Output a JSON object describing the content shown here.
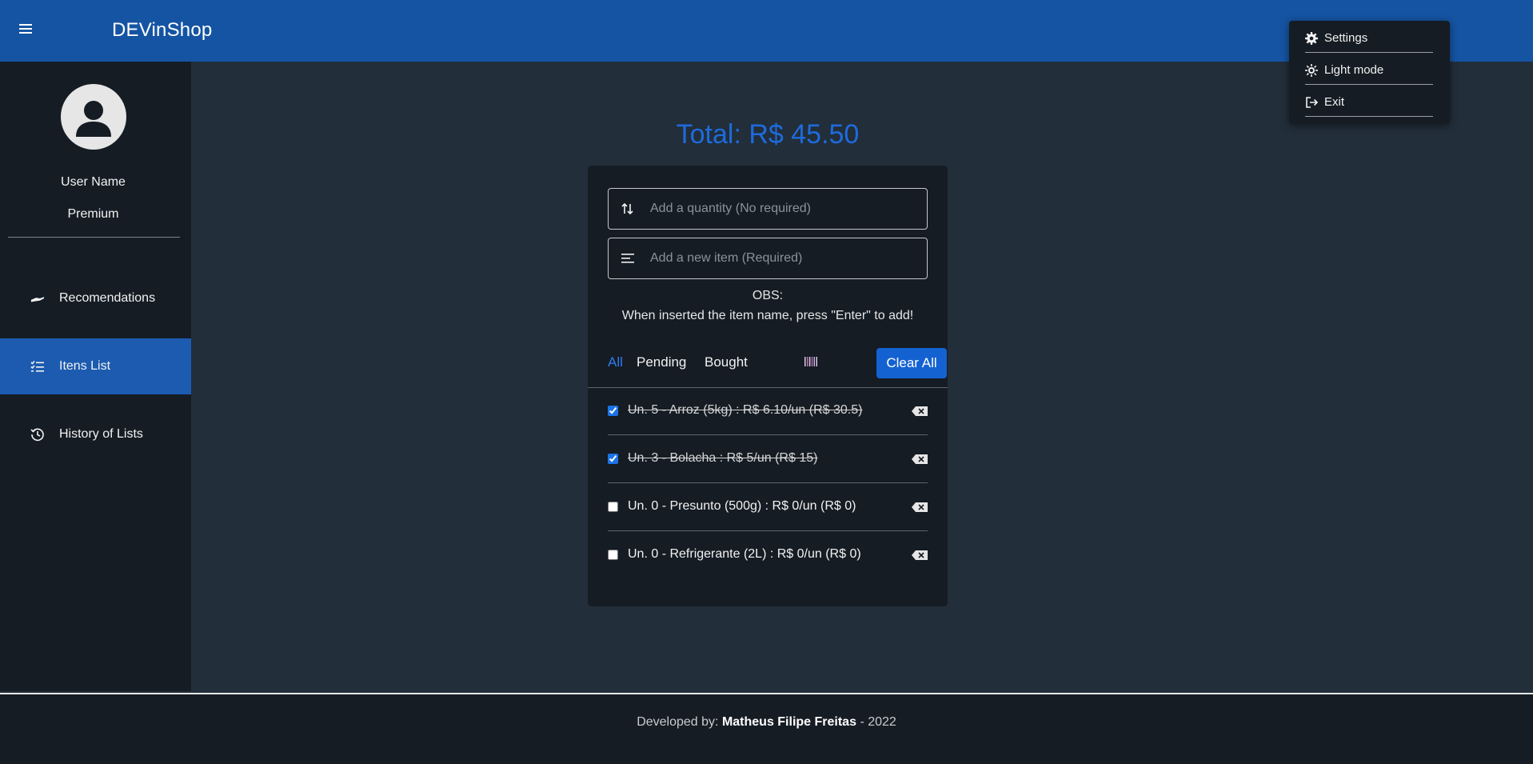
{
  "header": {
    "title": "DEVinShop"
  },
  "sidebar": {
    "user_name": "User Name",
    "user_plan": "Premium",
    "items": [
      {
        "label": "Recomendations",
        "icon": "hand-icon",
        "active": false
      },
      {
        "label": "Itens List",
        "icon": "checklist-icon",
        "active": true
      },
      {
        "label": "History of Lists",
        "icon": "history-icon",
        "active": false
      }
    ]
  },
  "main": {
    "total": "Total: R$ 45.50",
    "quantity_placeholder": "Add a quantity (No required)",
    "item_placeholder": "Add a new item (Required)",
    "obs_title": "OBS:",
    "obs_text": "When inserted the item name, press \"Enter\" to add!",
    "tabs": [
      {
        "label": "All",
        "active": true
      },
      {
        "label": "Pending",
        "active": false
      },
      {
        "label": "Bought",
        "active": false
      }
    ],
    "clear_all_label": "Clear All",
    "items": [
      {
        "text": "Un. 5 - Arroz (5kg) : R$ 6.10/un (R$ 30.5)",
        "checked": true
      },
      {
        "text": "Un. 3 - Bolacha : R$ 5/un (R$ 15)",
        "checked": true
      },
      {
        "text": "Un. 0 - Presunto (500g) : R$ 0/un (R$ 0)",
        "checked": false
      },
      {
        "text": "Un. 0 - Refrigerante (2L) : R$ 0/un (R$ 0)",
        "checked": false
      }
    ]
  },
  "dropdown": {
    "items": [
      {
        "label": "Settings",
        "icon": "gear-icon"
      },
      {
        "label": "Light mode",
        "icon": "sun-icon"
      },
      {
        "label": "Exit",
        "icon": "logout-icon"
      }
    ]
  },
  "footer": {
    "prefix": "Developed by:",
    "author": "Matheus Filipe Freitas",
    "suffix": "- 2022"
  },
  "colors": {
    "header": "#1554a3",
    "sidebar": "#151c24",
    "background": "#222e3a",
    "accent": "#1e6bdc",
    "active_nav": "#1c5bb0"
  }
}
